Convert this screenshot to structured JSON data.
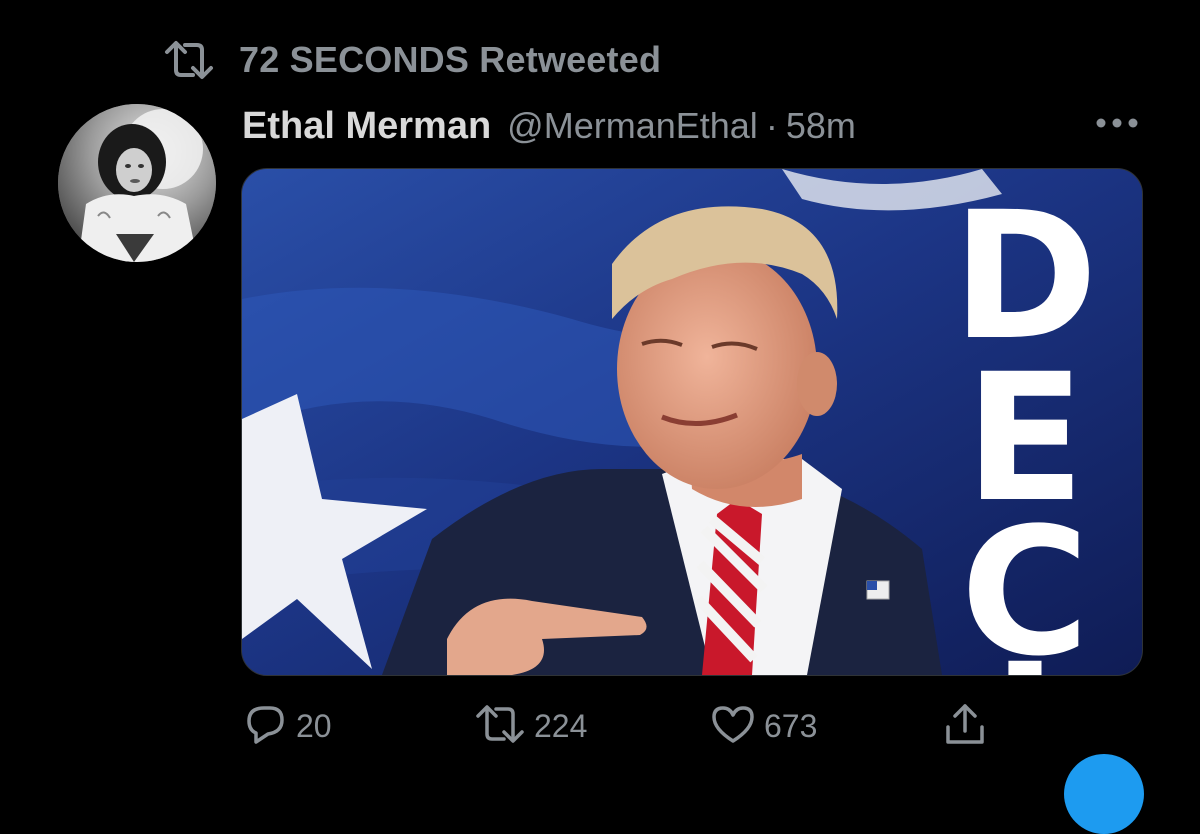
{
  "retweet_banner": {
    "text": "72 SECONDS Retweeted",
    "icon": "retweet-icon"
  },
  "tweet": {
    "author": {
      "display_name": "Ethal Merman",
      "handle": "@MermanEthal",
      "avatar_icon": "profile-photo"
    },
    "separator": "·",
    "timestamp": "58m",
    "more_icon": "more-horizontal-icon",
    "media": {
      "overlay_text": [
        "D",
        "E",
        "C",
        "I"
      ]
    },
    "actions": {
      "reply": {
        "icon": "reply-bubble-icon",
        "count": "20"
      },
      "retweet": {
        "icon": "retweet-icon",
        "count": "224"
      },
      "like": {
        "icon": "heart-icon",
        "count": "673"
      },
      "share": {
        "icon": "share-icon"
      }
    }
  },
  "colors": {
    "background": "#000000",
    "primary_text": "#d9d9d9",
    "secondary_text": "#8b9197",
    "accent": "#1d9bf0",
    "flag_blue": "#1a2a7a"
  }
}
